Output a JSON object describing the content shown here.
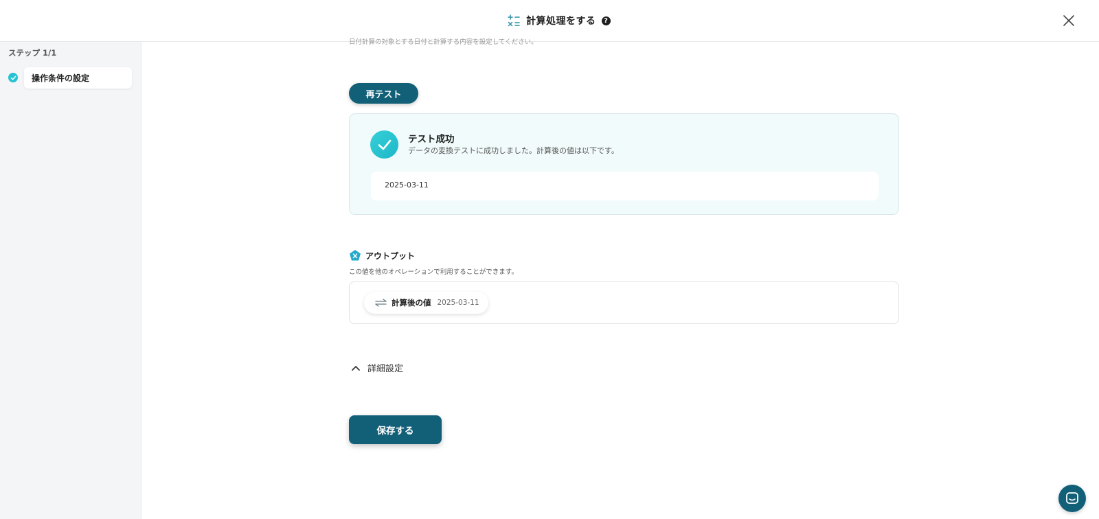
{
  "header": {
    "title": "計算処理をする",
    "icon": "calculator-icon",
    "help_icon": "help-icon",
    "close_icon": "close-icon"
  },
  "sidebar": {
    "step_count": "ステップ 1/1",
    "steps": [
      {
        "label": "操作条件の設定",
        "status": "completed",
        "icon": "check-circle-icon"
      }
    ]
  },
  "main": {
    "truncated_text": "日付計算の対象とする日付と計算する内容を設定してください。",
    "retest_label": "再テスト",
    "result": {
      "title": "テスト成功",
      "description": "データの変換テストに成功しました。計算後の値は以下です。",
      "value": "2025-03-11"
    },
    "output": {
      "title": "アウトプット",
      "description": "この値を他のオペレーションで利用することができます。",
      "items": [
        {
          "label": "計算後の値",
          "value": "2025-03-11",
          "icon": "swap-icon"
        }
      ]
    },
    "advanced_label": "詳細設定",
    "save_label": "保存する"
  },
  "colors": {
    "primary": "#126078",
    "accent": "#26c2d4",
    "success_bg": "#f2fbfb",
    "sidebar_bg": "#f4f5f6"
  },
  "chat_icon": "chat-icon"
}
